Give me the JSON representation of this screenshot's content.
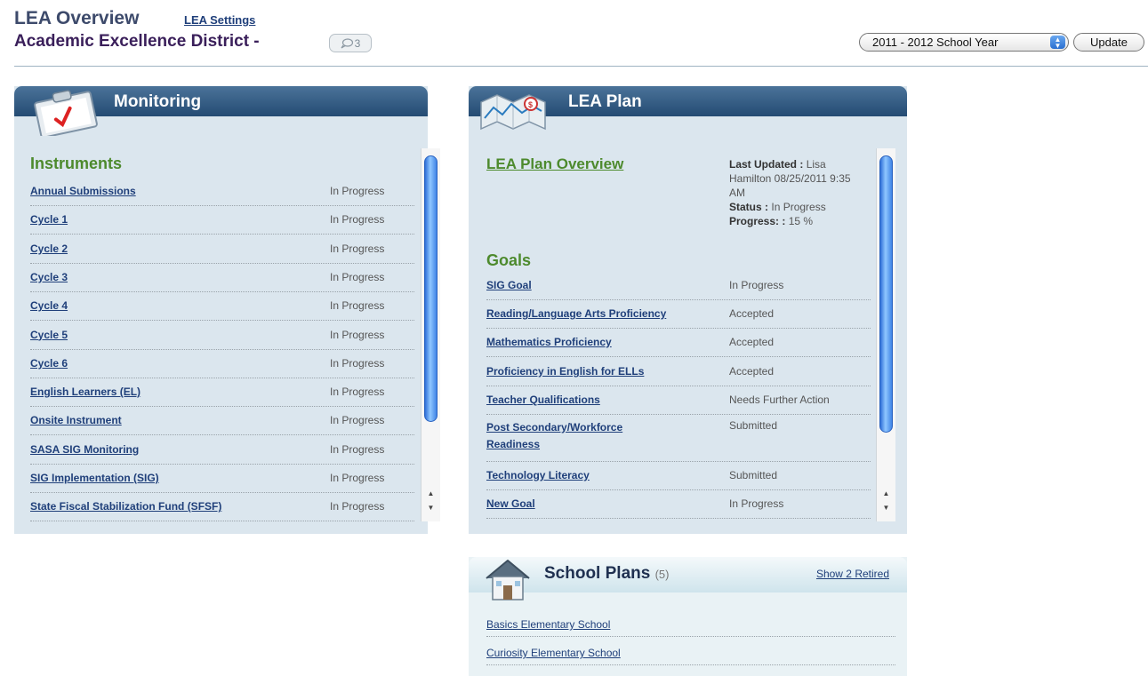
{
  "header": {
    "title": "LEA Overview",
    "settings_link": "LEA Settings",
    "district": "Academic Excellence District -",
    "comments_count": "3",
    "school_year": "2011 - 2012 School Year",
    "update_label": "Update"
  },
  "monitoring": {
    "title": "Monitoring",
    "section": "Instruments",
    "items": [
      {
        "label": "Annual Submissions",
        "status": "In Progress"
      },
      {
        "label": "Cycle 1",
        "status": "In Progress"
      },
      {
        "label": "Cycle 2",
        "status": "In Progress"
      },
      {
        "label": "Cycle 3",
        "status": "In Progress"
      },
      {
        "label": "Cycle 4",
        "status": "In Progress"
      },
      {
        "label": "Cycle 5",
        "status": "In Progress"
      },
      {
        "label": "Cycle 6",
        "status": "In Progress"
      },
      {
        "label": "English Learners (EL)",
        "status": "In Progress"
      },
      {
        "label": "Onsite Instrument",
        "status": "In Progress"
      },
      {
        "label": "SASA SIG Monitoring",
        "status": "In Progress"
      },
      {
        "label": "SIG Implementation (SIG)",
        "status": "In Progress"
      },
      {
        "label": "State Fiscal Stabilization Fund (SFSF)",
        "status": "In Progress"
      }
    ]
  },
  "lea_plan": {
    "title": "LEA Plan",
    "overview_link": "LEA Plan Overview",
    "last_updated_label": "Last Updated :",
    "last_updated_value": "Lisa Hamilton 08/25/2011 9:35 AM",
    "status_label": "Status :",
    "status_value": "In Progress",
    "progress_label": "Progress: :",
    "progress_value": "15 %",
    "goals_heading": "Goals",
    "goals": [
      {
        "label": "SIG Goal",
        "status": "In Progress"
      },
      {
        "label": "Reading/Language Arts Proficiency",
        "status": "Accepted"
      },
      {
        "label": "Mathematics Proficiency",
        "status": "Accepted"
      },
      {
        "label": "Proficiency in English for ELLs",
        "status": "Accepted"
      },
      {
        "label": "Teacher Qualifications",
        "status": "Needs Further Action"
      },
      {
        "label": "Post Secondary/Workforce Readiness",
        "status": "Submitted"
      },
      {
        "label": "Technology Literacy",
        "status": "Submitted"
      },
      {
        "label": "New Goal",
        "status": "In Progress"
      }
    ]
  },
  "school_plans": {
    "title": "School Plans",
    "count": "(5)",
    "retired_link": "Show 2 Retired",
    "items": [
      "Basics Elementary School",
      "Curiosity Elementary School"
    ]
  },
  "colors": {
    "panel_bar": "#244b73",
    "panel_bg": "#dbe6ee",
    "section_green": "#4d8a2d",
    "link_blue": "#1f3f7a"
  }
}
